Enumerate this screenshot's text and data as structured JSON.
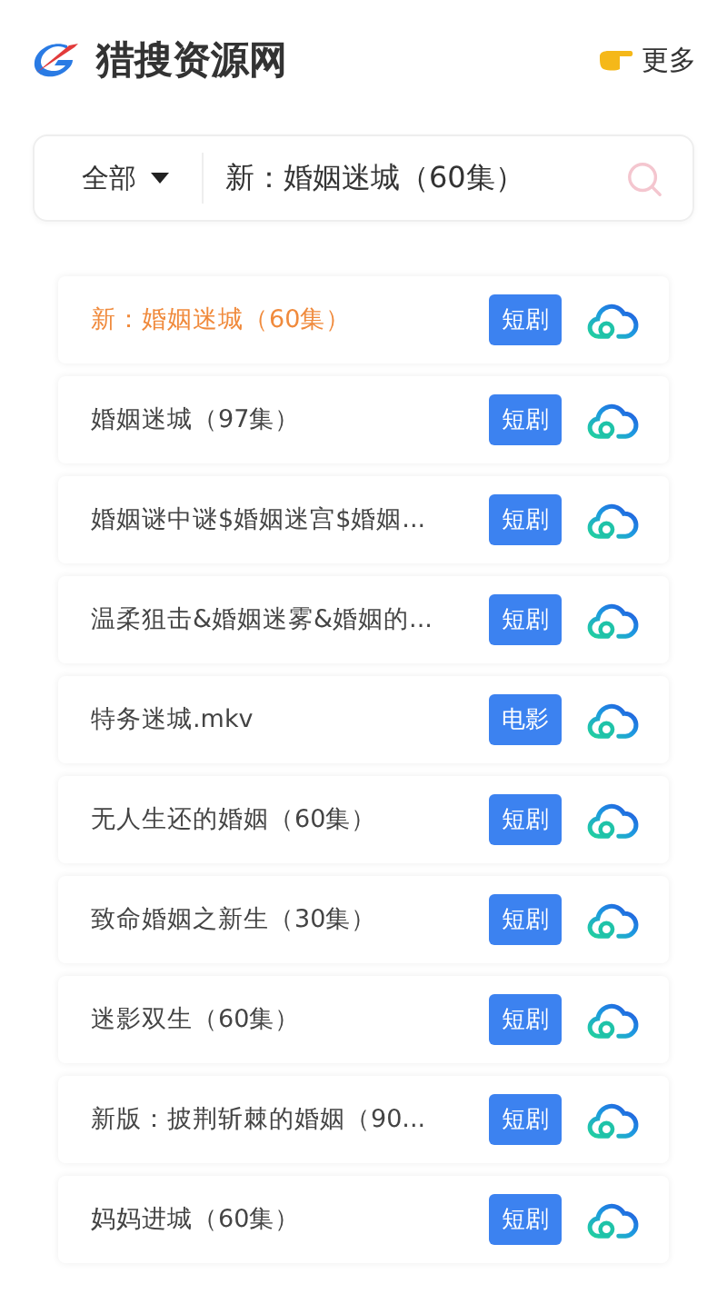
{
  "header": {
    "title": "猎搜资源网",
    "more": "更多"
  },
  "search": {
    "category": "全部",
    "value": "新：婚姻迷城（60集）"
  },
  "results": [
    {
      "title": "新：婚姻迷城（60集）",
      "tag": "短剧",
      "highlighted": true
    },
    {
      "title": "婚姻迷城（97集）",
      "tag": "短剧",
      "highlighted": false
    },
    {
      "title": "婚姻谜中谜$婚姻迷宫$婚姻...",
      "tag": "短剧",
      "highlighted": false
    },
    {
      "title": "温柔狙击&婚姻迷雾&婚姻的...",
      "tag": "短剧",
      "highlighted": false
    },
    {
      "title": "特务迷城.mkv",
      "tag": "电影",
      "highlighted": false
    },
    {
      "title": "无人生还的婚姻（60集）",
      "tag": "短剧",
      "highlighted": false
    },
    {
      "title": "致命婚姻之新生（30集）",
      "tag": "短剧",
      "highlighted": false
    },
    {
      "title": "迷影双生（60集）",
      "tag": "短剧",
      "highlighted": false
    },
    {
      "title": "新版：披荆斩棘的婚姻（90...",
      "tag": "短剧",
      "highlighted": false
    },
    {
      "title": "妈妈进城（60集）",
      "tag": "短剧",
      "highlighted": false
    }
  ]
}
